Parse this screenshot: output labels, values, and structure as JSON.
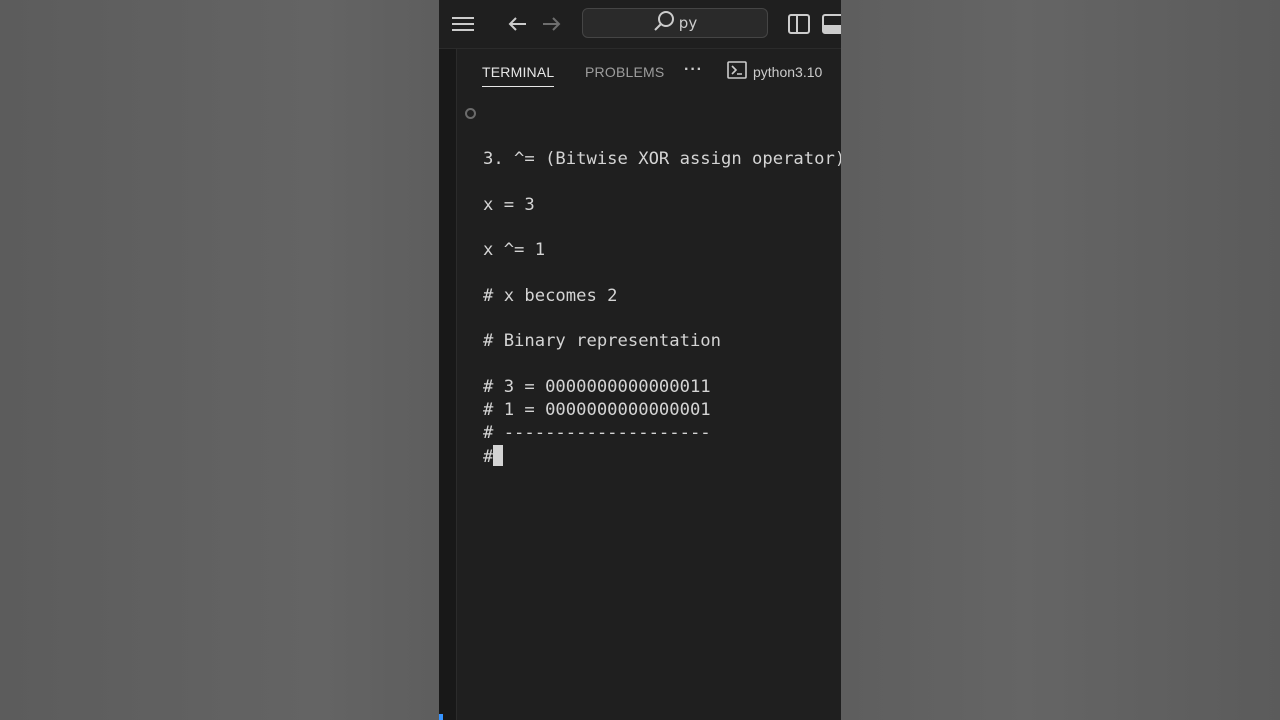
{
  "titlebar": {
    "search_text": "py",
    "icons": [
      "menu-icon",
      "arrow-left-icon",
      "arrow-right-icon",
      "search-icon",
      "toggle-sidebar-icon",
      "toggle-panel-icon"
    ]
  },
  "panel": {
    "tabs": [
      {
        "label": "TERMINAL",
        "active": true
      },
      {
        "label": "PROBLEMS",
        "active": false
      }
    ],
    "more_label": "···",
    "terminal_profile": "python3.10"
  },
  "terminal": {
    "lines": [
      "3. ^= (Bitwise XOR assign operator)",
      "x = 3",
      "x ^= 1",
      "# x becomes 2",
      "# Binary representation",
      "# 3 = 0000000000000011",
      "# 1 = 0000000000000001",
      "# --------------------",
      "#"
    ]
  },
  "colors": {
    "background": "#1f1f1f",
    "text": "#d4d4d4",
    "active_tab": "#e7e7e7",
    "inactive_tab": "#9d9d9d",
    "accent": "#3794ff"
  }
}
